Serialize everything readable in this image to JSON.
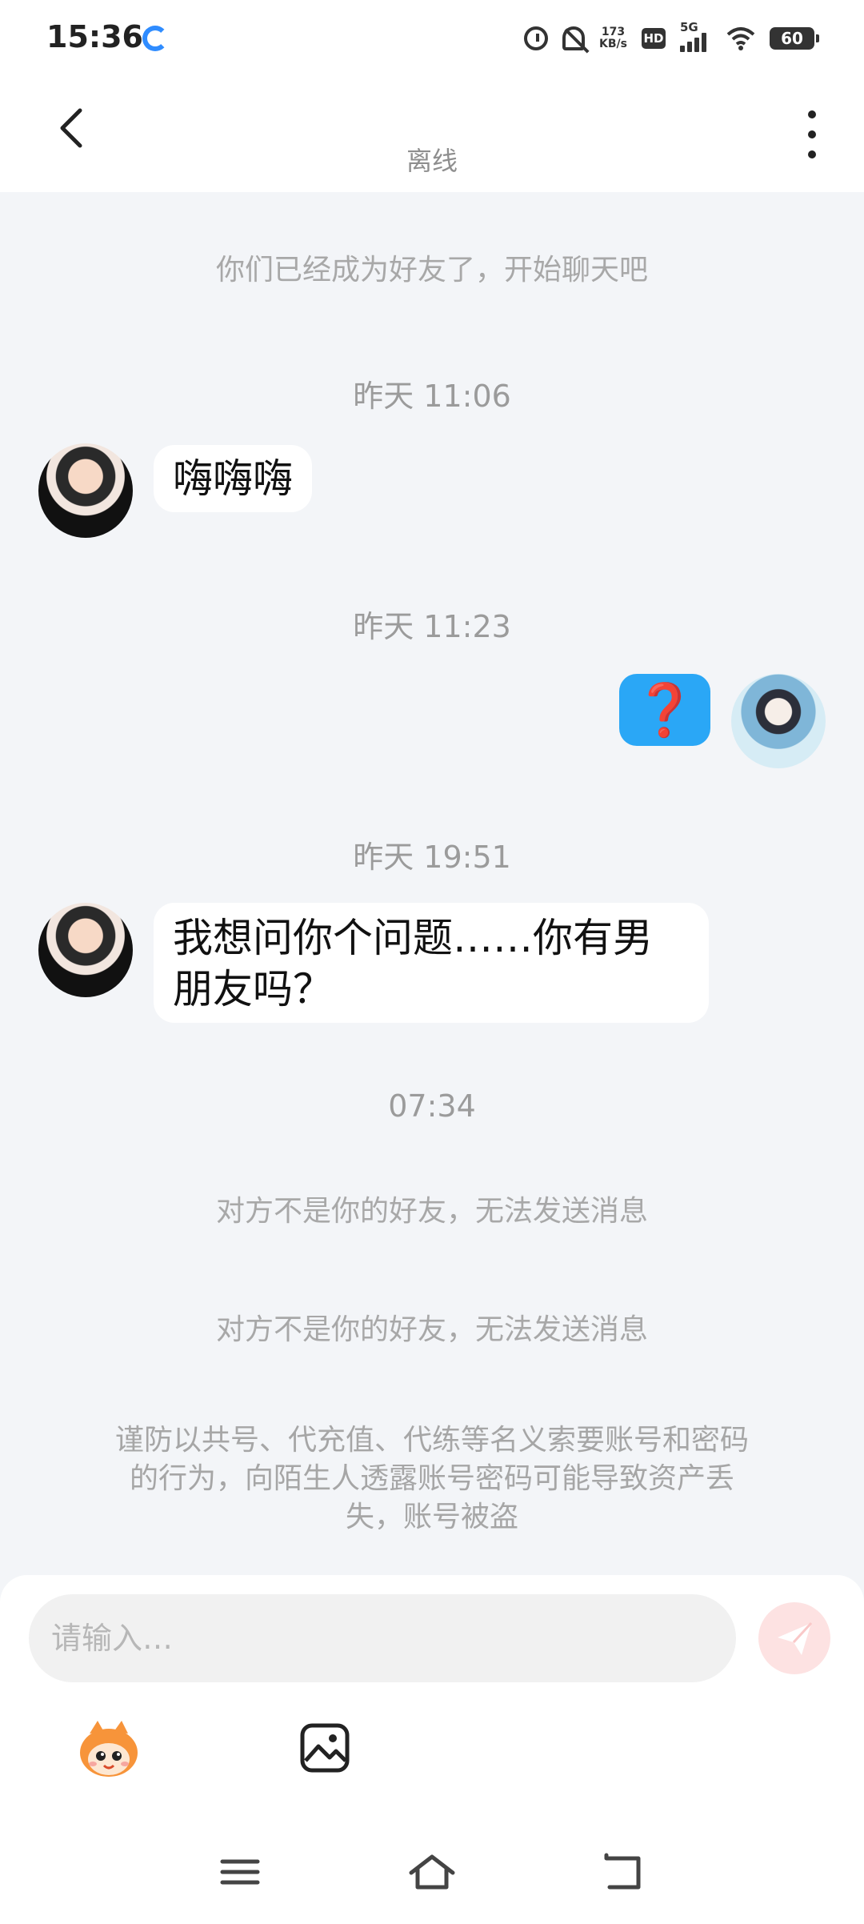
{
  "status_bar": {
    "time": "15:36",
    "net_speed_value": "173",
    "net_speed_unit": "KB/s",
    "hd_label": "HD",
    "network_label": "5G",
    "battery": "60"
  },
  "header": {
    "title": "离线"
  },
  "chat": {
    "friend_notice": "你们已经成为好友了，开始聊天吧",
    "timestamps": [
      "昨天 11:06",
      "昨天 11:23",
      "昨天 19:51",
      "07:34"
    ],
    "messages": [
      {
        "sender": "other",
        "text": "嗨嗨嗨"
      },
      {
        "sender": "me",
        "text": "❓"
      },
      {
        "sender": "other",
        "text_line1": "我想问你个问题……你有男",
        "text_line2": "朋友吗？"
      }
    ],
    "errors": [
      "对方不是你的好友，无法发送消息",
      "对方不是你的好友，无法发送消息"
    ],
    "warning_line1": "谨防以共号、代充值、代练等名义索要账号和密码",
    "warning_line2": "的行为，向陌生人透露账号密码可能导致资产丢",
    "warning_line3": "失，账号被盗"
  },
  "composer": {
    "placeholder": "请输入…"
  },
  "icons": {
    "back": "back-arrow-icon",
    "more": "more-vertical-icon",
    "send": "send-icon",
    "emoji": "emoji-mascot-icon",
    "image": "image-icon",
    "nav_menu": "menu-icon",
    "nav_home": "home-icon",
    "nav_back": "return-icon"
  },
  "colors": {
    "accent_blue": "#2aa7f6",
    "send_disabled": "#fde2e2",
    "chat_bg": "#f3f5f8"
  }
}
